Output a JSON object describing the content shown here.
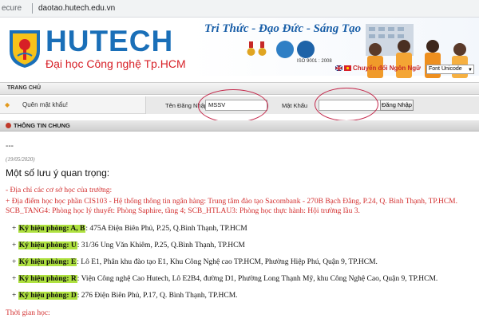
{
  "browser": {
    "secure_label": "ecure",
    "url": "daotao.hutech.edu.vn"
  },
  "header": {
    "brand": "HUTECH",
    "subtitle": "Đại học Công nghệ Tp.HCM",
    "slogan": "Tri Thức - Đạo Đức - Sáng Tạo",
    "cert_label": "ISO 9001 : 2008",
    "language_text": "Chuyển đổi Ngôn Ngữ",
    "font_select": "Font Unicode",
    "colors": {
      "brand_blue": "#1a6fb8",
      "brand_red": "#d71f26"
    }
  },
  "nav": {
    "home": "TRANG CHỦ"
  },
  "login": {
    "forgot": "Quên mật khẩu!",
    "username_label": "Tên Đăng Nhập",
    "username_value": "MSSV",
    "password_label": "Mật Khẩu",
    "password_value": "",
    "submit": "Đăng Nhập"
  },
  "section": {
    "title": "THÔNG TIN CHUNG"
  },
  "content": {
    "dashes": "---",
    "date": "(19/05/2020)",
    "heading": "Một số lưu ý quan trọng:",
    "address_title": "- Địa chỉ các cơ sở học của trường:",
    "address_line": "+ Địa điểm học học phần CIS103 - Hệ thống thông tin ngân hàng: Trung tâm đào tạo Sacombank - 270B Bạch Đằng, P.24, Q. Bình Thạnh, TP.HCM. SCB_TANG4: Phòng học lý thuyết: Phòng Saphire, tầng 4; SCB_HTLAU3: Phòng học thực hành: Hội trường lầu 3.",
    "rooms": [
      {
        "prefix": "+ ",
        "label": "Ký hiệu phòng: A, B",
        "address": ": 475A Điện Biên Phủ, P.25, Q.Bình Thạnh, TP.HCM"
      },
      {
        "prefix": "+ ",
        "label": "Ký hiệu phòng: U",
        "address": ": 31/36 Ung Văn Khiêm, P.25, Q.Bình Thạnh, TP.HCM"
      },
      {
        "prefix": "+ ",
        "label": "Ký hiệu phòng: E",
        "address": ": Lô E1, Phân khu đào tạo E1, Khu Công Nghệ cao TP.HCM, Phường Hiệp Phú, Quận 9, TP.HCM."
      },
      {
        "prefix": "+ ",
        "label": "Ký hiệu phòng: R",
        "address": ": Viện Công nghệ Cao Hutech, Lô E2B4, đường D1, Phường Long Thạnh Mỹ, khu Công Nghệ Cao, Quận 9, TP.HCM."
      },
      {
        "prefix": "+ ",
        "label": "Ký hiệu phòng: D",
        "address": ": 276 Điện Biên Phủ, P.17, Q. Bình Thạnh, TP.HCM."
      }
    ],
    "time_title": "Thời gian học:"
  }
}
